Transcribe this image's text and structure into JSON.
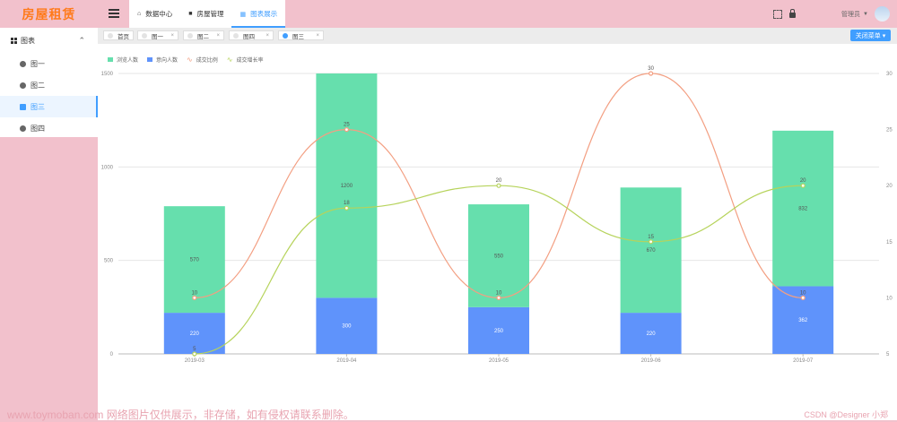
{
  "brand": {
    "title": "房屋租赁"
  },
  "sidebar": {
    "group_label": "图表",
    "items": [
      {
        "label": "图一",
        "active": false
      },
      {
        "label": "图二",
        "active": false
      },
      {
        "label": "图三",
        "active": true
      },
      {
        "label": "图四",
        "active": false
      }
    ]
  },
  "header": {
    "nav": [
      {
        "label": "数据中心",
        "icon": "home-icon",
        "active": false
      },
      {
        "label": "房屋管理",
        "icon": "building-icon",
        "active": false
      },
      {
        "label": "图表展示",
        "icon": "chart-grid-icon",
        "active": true
      }
    ],
    "user_name": "管理员"
  },
  "tags": [
    {
      "label": "首页",
      "closable": false,
      "active": false
    },
    {
      "label": "图一",
      "closable": true,
      "active": false
    },
    {
      "label": "图二",
      "closable": true,
      "active": false
    },
    {
      "label": "图四",
      "closable": true,
      "active": false
    },
    {
      "label": "图三",
      "closable": true,
      "active": true
    }
  ],
  "close_menu_label": "关闭菜单",
  "colors": {
    "bar_browse": "#66dfad",
    "bar_intent": "#5f93fb",
    "line_ratio": "#f39f82",
    "line_growth": "#b6d35b",
    "accent": "#409eff"
  },
  "chart_data": {
    "type": "bar",
    "categories": [
      "2019-03",
      "2019-04",
      "2019-05",
      "2019-06",
      "2019-07"
    ],
    "series": [
      {
        "name": "浏览人数",
        "type": "bar",
        "stack": true,
        "values": [
          570,
          1200,
          550,
          670,
          832
        ]
      },
      {
        "name": "意向人数",
        "type": "bar",
        "stack": true,
        "values": [
          220,
          300,
          250,
          220,
          362
        ]
      },
      {
        "name": "成交比例",
        "type": "line",
        "axis": "right",
        "values": [
          10,
          25,
          10,
          30,
          10
        ]
      },
      {
        "name": "成交增长率",
        "type": "line",
        "axis": "right",
        "values": [
          5,
          18,
          20,
          15,
          20
        ]
      }
    ],
    "y_left": {
      "min": 0,
      "max": 1500,
      "ticks": [
        0,
        500,
        1000,
        1500
      ]
    },
    "y_right": {
      "min": 5,
      "max": 30,
      "ticks": [
        5,
        10,
        15,
        20,
        25,
        30
      ]
    },
    "legend_position": "top-left",
    "grid": true
  },
  "watermark": {
    "left": "www.toymoban.com 网络图片仅供展示，非存储，如有侵权请联系删除。",
    "right": "CSDN @Designer 小郑"
  }
}
